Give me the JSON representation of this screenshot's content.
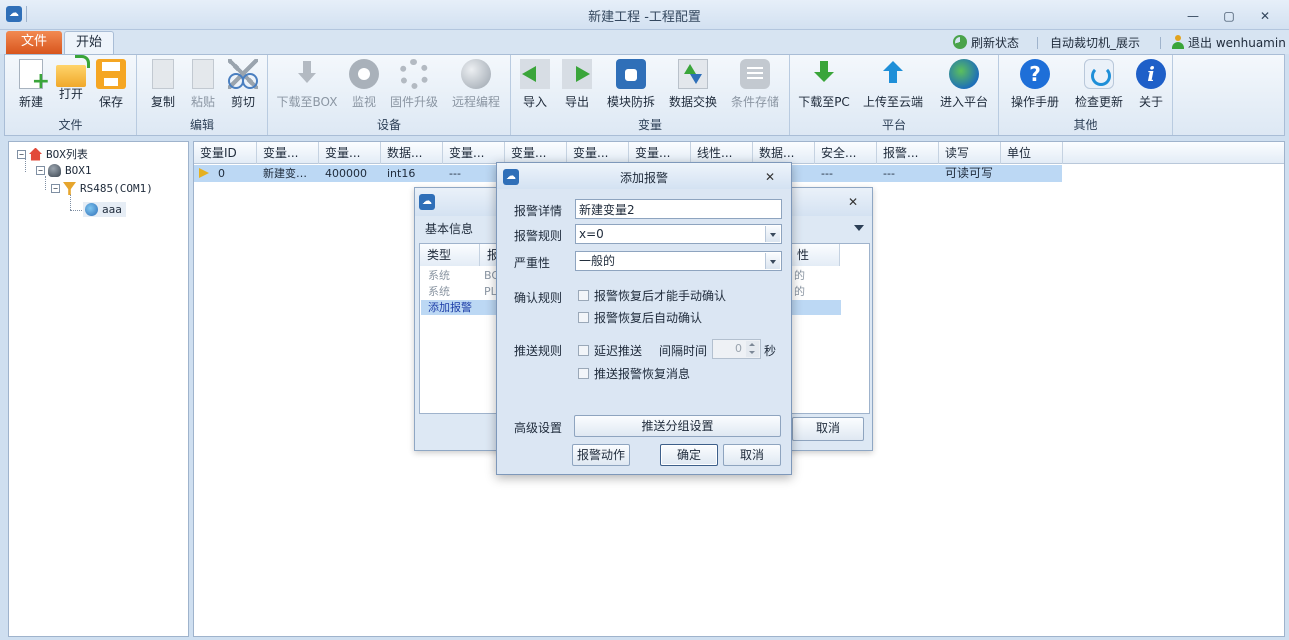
{
  "window": {
    "title": "新建工程 -工程配置",
    "controls": {
      "minimize": "—",
      "restore": "▢",
      "close": "✕"
    }
  },
  "tabs": {
    "file": "文件",
    "start": "开始"
  },
  "status": {
    "refresh": "刷新状态",
    "project": "自动裁切机_展示",
    "logout": "退出 wenhuamin"
  },
  "ribbon": {
    "file": {
      "label": "文件",
      "new": "新建",
      "open": "打开",
      "save": "保存"
    },
    "edit": {
      "label": "编辑",
      "copy": "复制",
      "paste": "粘贴",
      "cut": "剪切"
    },
    "device": {
      "label": "设备",
      "download_box": "下载至BOX",
      "monitor": "监视",
      "firmware": "固件升级",
      "remote": "远程编程"
    },
    "variable": {
      "label": "变量",
      "import": "导入",
      "export": "导出",
      "anti_tamper": "模块防拆",
      "data_exchange": "数据交换",
      "conditional_store": "条件存储"
    },
    "platform": {
      "label": "平台",
      "download_pc": "下载至PC",
      "upload_cloud": "上传至云端",
      "enter_platform": "进入平台"
    },
    "other": {
      "label": "其他",
      "manual": "操作手册",
      "check_update": "检查更新",
      "about": "关于"
    }
  },
  "tree": {
    "root": "BOX列表",
    "box": "BOX1",
    "port": "RS485(COM1)",
    "item": "aaa",
    "expander_minus": "−"
  },
  "table": {
    "headers": [
      "变量ID",
      "变量...",
      "变量...",
      "数据...",
      "变量...",
      "变量...",
      "变量...",
      "变量...",
      "线性...",
      "数据...",
      "安全...",
      "报警...",
      "读写",
      "单位"
    ],
    "rows": [
      [
        "0",
        "新建变…",
        "400000",
        "int16",
        "---",
        "",
        "",
        "",
        "",
        "",
        "---",
        "---",
        "可读可写",
        ""
      ]
    ]
  },
  "bg_dialog": {
    "close": "✕",
    "section": "基本信息",
    "headers": {
      "type": "类型",
      "col2": "报",
      "col_right": "性"
    },
    "rows": [
      {
        "type": "系统",
        "col2": "BO",
        "right": "的"
      },
      {
        "type": "系统",
        "col2": "PL",
        "right": "的"
      },
      {
        "type": "添加报警",
        "col2": "",
        "right": ""
      }
    ],
    "cancel": "取消"
  },
  "dialog": {
    "title": "添加报警",
    "close": "✕",
    "alarm_detail_label": "报警详情",
    "alarm_detail_value": "新建变量2",
    "alarm_rule_label": "报警规则",
    "alarm_rule_value": "x=0",
    "severity_label": "严重性",
    "severity_value": "一般的",
    "confirm_rule_label": "确认规则",
    "confirm_manual": "报警恢复后才能手动确认",
    "confirm_auto": "报警恢复后自动确认",
    "push_rule_label": "推送规则",
    "delay_push": "延迟推送",
    "interval_label": "间隔时间",
    "interval_value": "0",
    "interval_unit": "秒",
    "push_recovery": "推送报警恢复消息",
    "advanced_label": "高级设置",
    "push_group_button": "推送分组设置",
    "alarm_action_button": "报警动作",
    "ok_button": "确定",
    "cancel_button": "取消"
  }
}
